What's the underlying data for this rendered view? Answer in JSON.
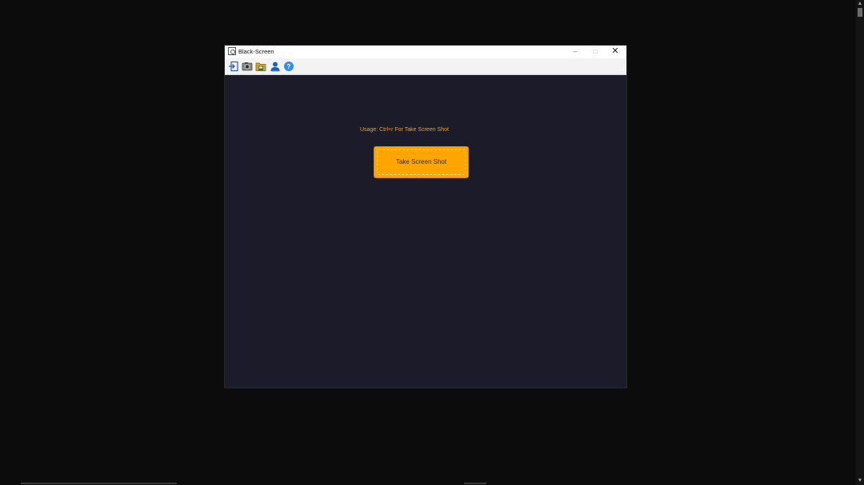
{
  "window": {
    "title": "Black-Screen",
    "controls": {
      "minimize": "–",
      "maximize": "□",
      "close": "✕"
    }
  },
  "toolbar": {
    "icons": [
      "exit-icon",
      "camera-icon",
      "folder-icon",
      "user-icon",
      "help-icon"
    ]
  },
  "main": {
    "usage_text": "Usage: Ctrl+r For Take Screen Shot",
    "button_label": "Take Screen Shot"
  },
  "colors": {
    "accent": "#ffa500",
    "usage_text": "#f0a11a",
    "background": "#1c1b29"
  }
}
